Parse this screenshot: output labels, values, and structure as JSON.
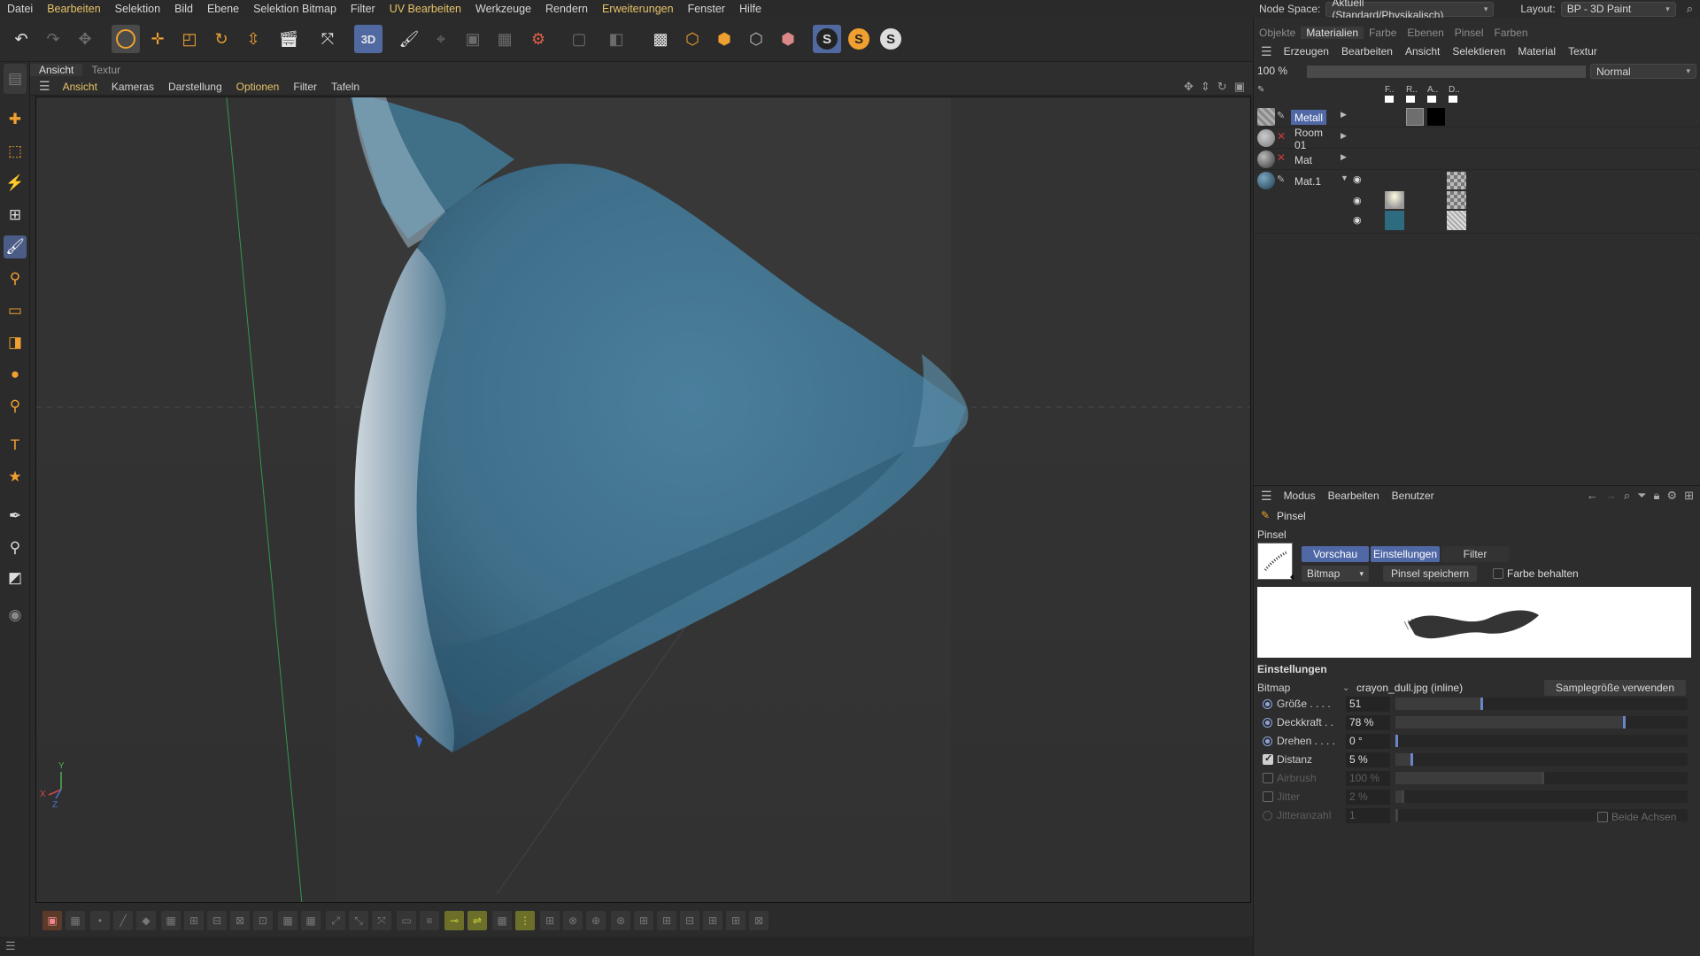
{
  "menubar": {
    "items": [
      "Datei",
      "Bearbeiten",
      "Selektion",
      "Bild",
      "Ebene",
      "Selektion Bitmap",
      "Filter",
      "UV Bearbeiten",
      "Werkzeuge",
      "Rendern",
      "Erweiterungen",
      "Fenster",
      "Hilfe"
    ],
    "node_space_label": "Node Space:",
    "node_space_value": "Aktuell (Standard/Physikalisch)",
    "layout_label": "Layout:",
    "layout_value": "BP - 3D Paint"
  },
  "viewport": {
    "tabs": [
      "Ansicht",
      "Textur"
    ],
    "menu": [
      "Ansicht",
      "Kameras",
      "Darstellung",
      "Optionen",
      "Filter",
      "Tafeln"
    ],
    "axis_labels": {
      "y": "Y",
      "x": "X",
      "z": "Z"
    }
  },
  "toolbar": {
    "s_icons": [
      "S",
      "S",
      "S"
    ],
    "paint3d_label": "3D"
  },
  "materials_panel": {
    "tabs": [
      "Objekte",
      "Materialien",
      "Farbe",
      "Ebenen",
      "Pinsel",
      "Farben"
    ],
    "active_tab": "Materialien",
    "menu": [
      "Erzeugen",
      "Bearbeiten",
      "Ansicht",
      "Selektieren",
      "Material",
      "Textur"
    ],
    "zoom": "100 %",
    "blend_mode": "Normal",
    "channel_headers": [
      "F..",
      "R..",
      "A..",
      "D.."
    ],
    "materials": [
      {
        "name": "Metall",
        "selected": true
      },
      {
        "name": "Room 01",
        "selected": false
      },
      {
        "name": "Mat",
        "selected": false
      },
      {
        "name": "Mat.1",
        "selected": false
      }
    ]
  },
  "attributes_panel": {
    "menu": [
      "Modus",
      "Bearbeiten",
      "Benutzer"
    ],
    "title": "Pinsel",
    "section": "Pinsel",
    "subtabs": [
      "Vorschau",
      "Einstellungen",
      "Filter"
    ],
    "active_subtabs": [
      "Vorschau",
      "Einstellungen"
    ],
    "brush_type": "Bitmap",
    "save_brush": "Pinsel speichern",
    "keep_color": "Farbe behalten",
    "keep_color_checked": false,
    "settings_title": "Einstellungen",
    "bitmap_label": "Bitmap",
    "bitmap_value": "crayon_dull.jpg (inline)",
    "use_sample_size": "Samplegröße verwenden",
    "props": [
      {
        "label": "Größe . . . .",
        "value": "51",
        "level": 0.29,
        "enabled": true,
        "control": "radio"
      },
      {
        "label": "Deckkraft . .",
        "value": "78 %",
        "level": 0.78,
        "enabled": true,
        "control": "radio"
      },
      {
        "label": "Drehen . . . .",
        "value": "0 °",
        "level": 0.0,
        "enabled": true,
        "control": "radio"
      },
      {
        "label": "Distanz",
        "value": "5 %",
        "level": 0.05,
        "enabled": true,
        "control": "checkbox",
        "checked": true
      },
      {
        "label": "Airbrush",
        "value": "100 %",
        "level": 0.5,
        "enabled": false,
        "control": "checkbox",
        "checked": false
      },
      {
        "label": "Jitter",
        "value": "2 %",
        "level": 0.02,
        "enabled": false,
        "control": "checkbox",
        "checked": false
      },
      {
        "label": "Jitteranzahl",
        "value": "1",
        "level": 0.0,
        "enabled": false,
        "control": "radio"
      }
    ],
    "both_axes": "Beide Achsen"
  },
  "colors": {
    "accent": "#5068a6",
    "highlight_text": "#e8c36a",
    "tool_orange": "#f0a030",
    "object_blue": "#4b7f9c"
  }
}
